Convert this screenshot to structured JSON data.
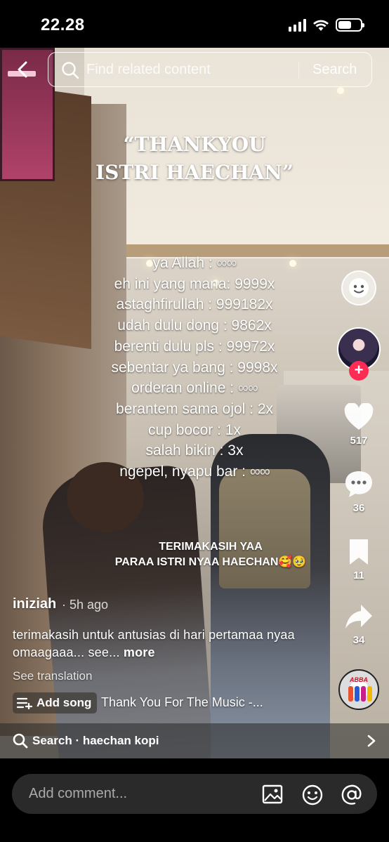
{
  "status_bar": {
    "time": "22.28",
    "battery_level": 0.6
  },
  "search": {
    "placeholder": "Find related content",
    "button": "Search"
  },
  "video": {
    "title_line1": "“THANKYOU",
    "title_line2": "ISTRI HAECHAN”",
    "counts": [
      {
        "label": "ya Allah : ",
        "value": "∞∞"
      },
      {
        "label": "eh ini yang mana: 9999x",
        "value": ""
      },
      {
        "label": "astaghfirullah : 999182x",
        "value": ""
      },
      {
        "label": "udah dulu dong : 9862x",
        "value": ""
      },
      {
        "label": "berenti dulu pls : 99972x",
        "value": ""
      },
      {
        "label": "sebentar ya bang : 9998x",
        "value": ""
      },
      {
        "label": "orderan online : ",
        "value": "∞∞"
      },
      {
        "label": "berantem sama ojol : 2x",
        "value": ""
      },
      {
        "label": "cup bocor : 1x",
        "value": ""
      },
      {
        "label": "salah bikin : 3x",
        "value": ""
      },
      {
        "label": "ngepel, nyapu bar : ",
        "value": "∞∞"
      }
    ],
    "caption_line1": "TERIMAKASIH YAA",
    "caption_line2": "PARAA ISTRI NYAA HAECHAN🥰🥹"
  },
  "actions": {
    "likes": "517",
    "comments": "36",
    "saves": "11",
    "shares": "34"
  },
  "post": {
    "author": "iniziah",
    "time": "· 5h ago",
    "description": "terimakasih untuk antusias di hari pertamaa nyaa omaagaaa... see... ",
    "more": "more",
    "see_translation": "See translation",
    "add_song": "Add song",
    "song": "Thank You For The Music -...",
    "sound_label": "ABBA"
  },
  "suggest": {
    "prefix": "Search",
    "query": "· haechan kopi"
  },
  "comment": {
    "placeholder": "Add comment..."
  }
}
